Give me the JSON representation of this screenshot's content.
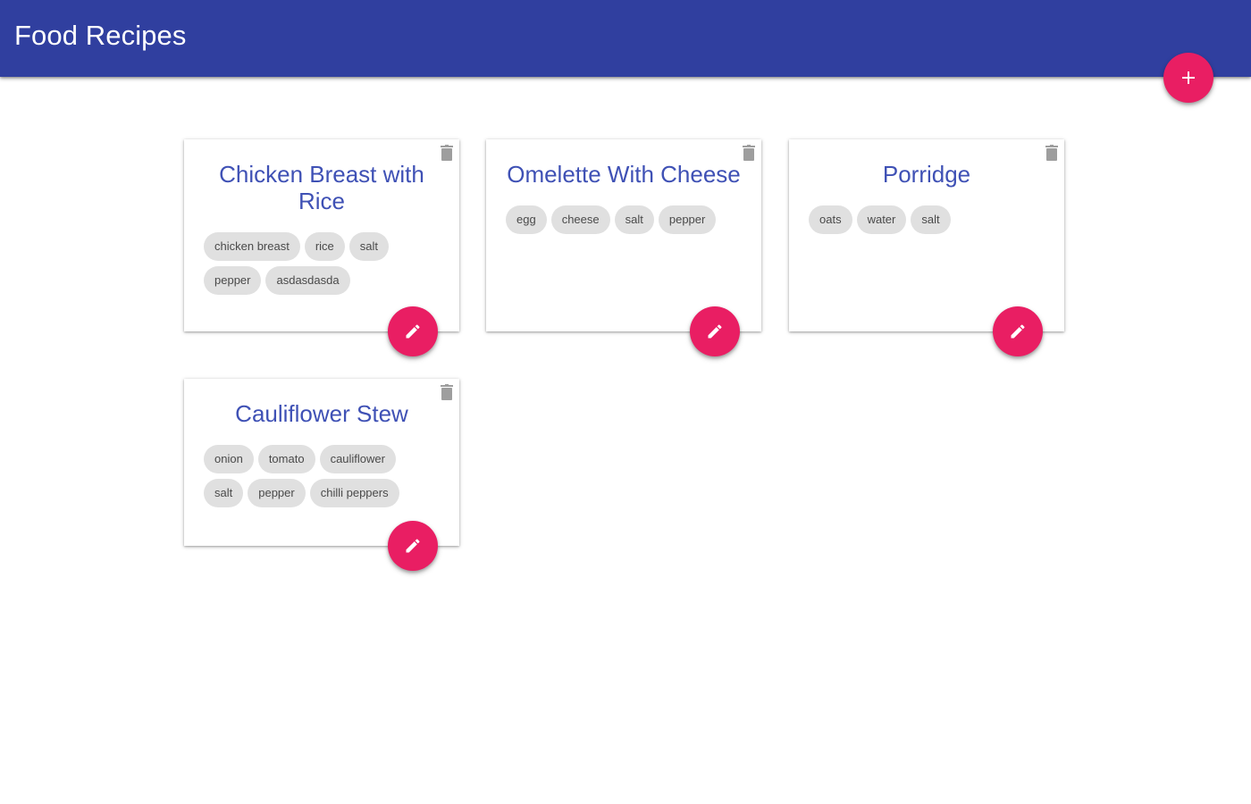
{
  "app": {
    "title": "Food Recipes"
  },
  "colors": {
    "primary": "#303f9f",
    "accent": "#e91e63",
    "card_title": "#3f51b5",
    "chip_bg": "#e0e0e0"
  },
  "icons": {
    "add": "plus-icon",
    "delete": "trash-icon",
    "edit": "pencil-icon"
  },
  "recipes": [
    {
      "title": "Chicken Breast with Rice",
      "ingredients": [
        "chicken breast",
        "rice",
        "salt",
        "pepper",
        "asdasdasda"
      ]
    },
    {
      "title": "Omelette With Cheese",
      "ingredients": [
        "egg",
        "cheese",
        "salt",
        "pepper"
      ]
    },
    {
      "title": "Porridge",
      "ingredients": [
        "oats",
        "water",
        "salt"
      ]
    },
    {
      "title": "Cauliflower Stew",
      "ingredients": [
        "onion",
        "tomato",
        "cauliflower",
        "salt",
        "pepper",
        "chilli peppers"
      ]
    }
  ]
}
